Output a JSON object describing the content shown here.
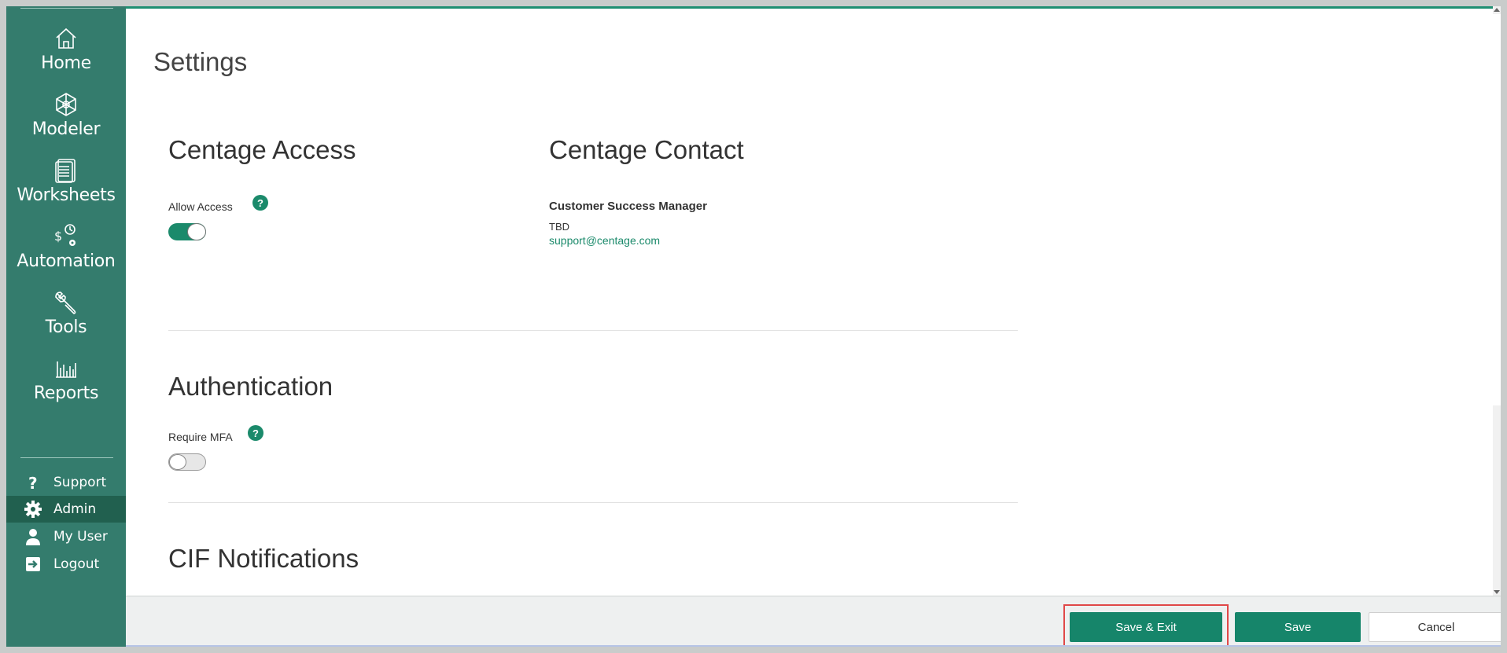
{
  "sidebar": {
    "nav": [
      {
        "label": "Home",
        "icon": "home-icon"
      },
      {
        "label": "Modeler",
        "icon": "modeler-icon"
      },
      {
        "label": "Worksheets",
        "icon": "worksheets-icon"
      },
      {
        "label": "Automation",
        "icon": "automation-icon"
      },
      {
        "label": "Tools",
        "icon": "tools-icon"
      },
      {
        "label": "Reports",
        "icon": "reports-icon"
      }
    ],
    "utility": [
      {
        "label": "Support",
        "icon": "question-icon"
      },
      {
        "label": "Admin",
        "icon": "gear-icon",
        "active": true
      },
      {
        "label": "My User",
        "icon": "user-icon"
      },
      {
        "label": "Logout",
        "icon": "logout-icon"
      }
    ]
  },
  "main": {
    "page_title": "Settings",
    "access": {
      "title": "Centage Access",
      "allow_label": "Allow Access",
      "help": "?",
      "allow_on": true
    },
    "contact": {
      "title": "Centage Contact",
      "role": "Customer Success Manager",
      "name": "TBD",
      "email": "support@centage.com"
    },
    "auth": {
      "title": "Authentication",
      "mfa_label": "Require MFA",
      "help": "?",
      "mfa_on": false
    },
    "cif": {
      "title": "CIF Notifications"
    }
  },
  "footer": {
    "save_exit": "Save & Exit",
    "save": "Save",
    "cancel": "Cancel"
  },
  "colors": {
    "sidebar_bg": "#347c6d",
    "active_bg": "#21604f",
    "accent": "#1b8a6b",
    "highlight": "#e04848"
  }
}
